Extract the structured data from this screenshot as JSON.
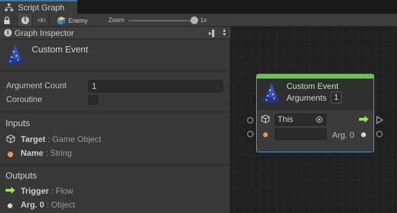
{
  "window": {
    "tab_title": "Script Graph"
  },
  "toolbar": {
    "object_name": "Enemy",
    "zoom_label": "Zoom",
    "zoom_value": "1x",
    "zoom_level": 1.0
  },
  "inspector": {
    "header_title": "Graph Inspector",
    "node_title": "Custom Event",
    "argument_count_label": "Argument Count",
    "argument_count_value": "1",
    "coroutine_label": "Coroutine",
    "coroutine_checked": false,
    "inputs_heading": "Inputs",
    "inputs": [
      {
        "name": "Target",
        "type": ": Game Object",
        "icon": "cube-icon"
      },
      {
        "name": "Name",
        "type": ": String",
        "icon": "orange-dot-icon"
      }
    ],
    "outputs_heading": "Outputs",
    "outputs": [
      {
        "name": "Trigger",
        "type": ": Flow",
        "icon": "flow-arrow-icon"
      },
      {
        "name": "Arg. 0",
        "type": ": Object",
        "icon": "white-dot-icon"
      }
    ]
  },
  "node": {
    "title": "Custom Event",
    "arguments_label": "Arguments",
    "arguments_value": "1",
    "target_value": "This",
    "name_value": "",
    "arg_output_label": "Arg. 0"
  },
  "colors": {
    "accent_blue": "#3a79bb",
    "node_bar": "#6ac24a",
    "flow_arrow": "#9ee05a",
    "string_port": "#e8955a",
    "selection_border": "#55a1d8"
  }
}
